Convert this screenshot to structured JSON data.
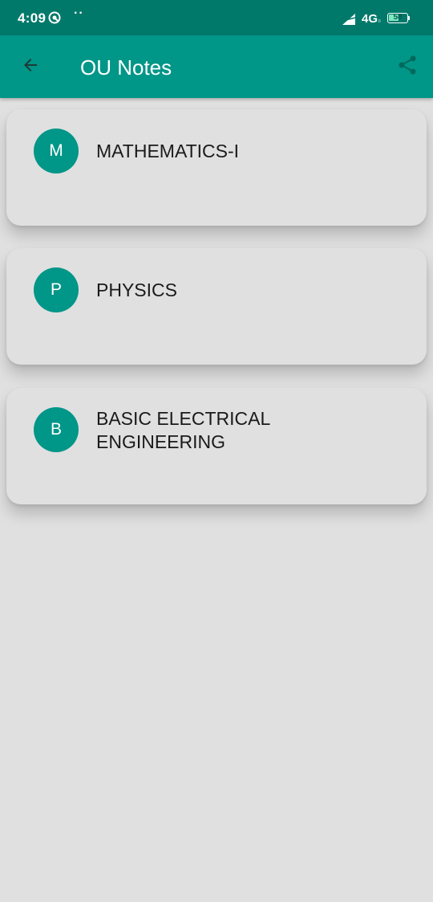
{
  "status_bar": {
    "time": "4:09",
    "dots": "··",
    "network": "4G",
    "network_sub": "ll",
    "battery_level": "58",
    "battery_percent": 58
  },
  "app_bar": {
    "title": "OU Notes",
    "back_icon": "arrow-back-icon",
    "share_icon": "share-icon"
  },
  "subjects": [
    {
      "initial": "M",
      "name": "MATHEMATICS-I"
    },
    {
      "initial": "P",
      "name": "PHYSICS"
    },
    {
      "initial": "B",
      "name": "BASIC ELECTRICAL ENGINEERING"
    }
  ],
  "colors": {
    "status_bar": "#00796b",
    "app_bar": "#009688",
    "avatar": "#009688",
    "background": "#e0e0e0",
    "share_icon": "#00695c"
  }
}
